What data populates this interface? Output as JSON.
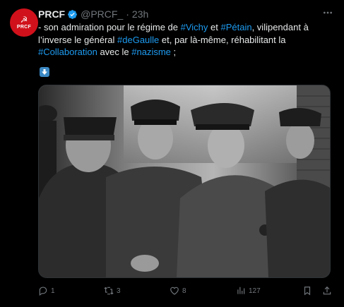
{
  "author": {
    "avatar_text": "PRCF",
    "name": "PRCF",
    "handle": "@PRCF_",
    "separator": "·",
    "time": "23h"
  },
  "tweet": {
    "line1_a": "- son admiration pour le régime de ",
    "tag_vichy": "#Vichy",
    "line1_b": " et ",
    "tag_petain": "#Pétain",
    "line1_c": ", vilipendant à",
    "line2_a": "l’inverse le général ",
    "tag_degaulle": "#deGaulle",
    "line2_b": " et, par là-même, réhabilitant la",
    "tag_collab": "#Collaboration",
    "line3_a": " avec le ",
    "tag_nazisme": "#nazisme",
    "line3_b": " ;"
  },
  "stats": {
    "replies": "1",
    "reposts": "3",
    "likes": "8",
    "views": "127"
  },
  "icons": {
    "verified": "verified-badge-icon",
    "more": "more-icon",
    "down_arrow": "down-arrow-emoji-icon",
    "reply": "reply-icon",
    "repost": "repost-icon",
    "like": "like-icon",
    "views": "views-icon",
    "bookmark": "bookmark-icon",
    "share": "share-icon"
  },
  "colors": {
    "background": "#000000",
    "text": "#e7e9ea",
    "muted": "#71767b",
    "accent": "#1d9bf0",
    "avatar": "#d0111b"
  }
}
